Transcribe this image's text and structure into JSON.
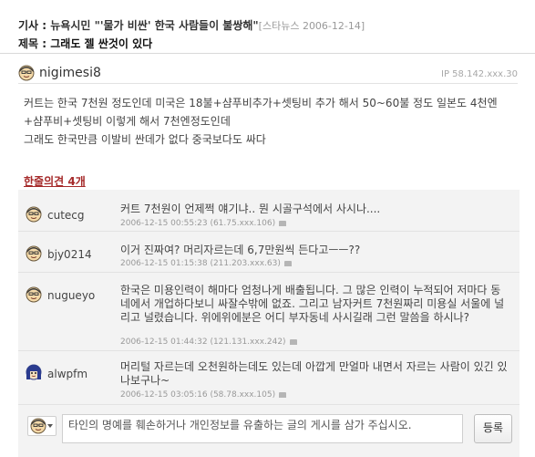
{
  "article": {
    "label": "기사 : ",
    "title": "뉴욕시민 \"'물가 비싼' 한국 사람들이 불쌍해\"",
    "source": "[스타뉴스 2006-12-14]"
  },
  "subject": {
    "label": "제목 : ",
    "text": "그래도 젤 싼것이 있다"
  },
  "post": {
    "username": "nigimesi8",
    "ip": "IP 58.142.xxx.30",
    "lines": [
      "커트는 한국 7천원 정도인데 미국은 18불+샴푸비추가+셋팅비 추가 해서 50~60불 정도 일본도 4천엔",
      "+샴푸비+셋팅비 이렇게 해서 7천엔정도인데",
      "그래도 한국만큼 이발비 싼데가 없다 중국보다도 싸다"
    ]
  },
  "replies": {
    "title": "한줄의견 4개",
    "items": [
      {
        "name": "cutecg",
        "text": "커트 7천원이 언제쩍 얘기냐.. 뭔 시골구석에서 사시나....",
        "meta": "2006-12-15 00:55:23 (61.75.xxx.106)"
      },
      {
        "name": "bjy0214",
        "text": "이거 진짜여? 머리자르는데 6,7만원씩 든다고ㅡㅡ??",
        "meta": "2006-12-15 01:15:38 (211.203.xxx.63)"
      },
      {
        "name": "nugueyo",
        "text": "한국은 미용인력이 해마다 엄청나게 배출됩니다. 그 많은 인력이 누적되어 저마다 동네에서 개업하다보니 싸잘수밖에 없죠. 그리고 남자커트 7천원짜리 미용실 서울에 널리고 널렸습니다. 위에위에분은 어디 부자동네 사시길래 그런 말씀을 하시나?",
        "meta": "2006-12-15 01:44:32 (121.131.xxx.242)"
      },
      {
        "name": "alwpfm",
        "text": "머리털 자르는데 오천원하는데도 있는데 아깝게 만얼마 내면서 자르는 사람이 있긴 있나보구나~",
        "meta": "2006-12-15 03:05:16 (58.78.xxx.105)"
      }
    ],
    "input_placeholder": "타인의 명예를 훼손하거나 개인정보를 유출하는 글의 게시를 삼가 주십시오.",
    "submit_label": "등록"
  }
}
